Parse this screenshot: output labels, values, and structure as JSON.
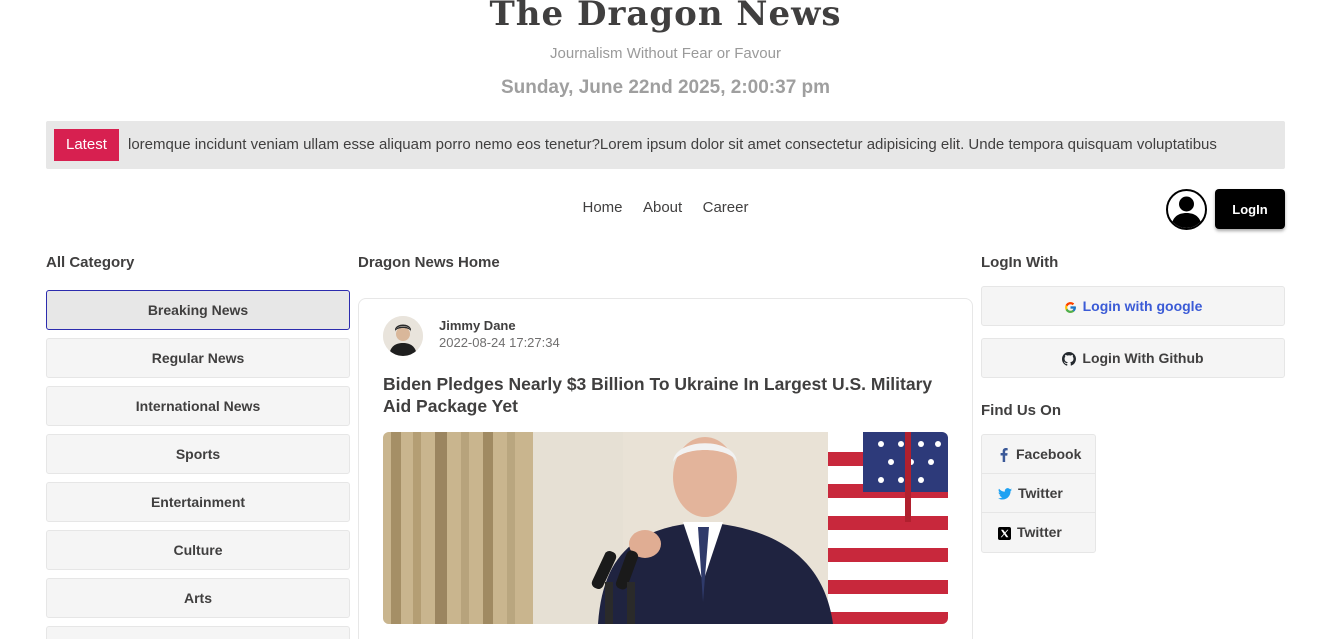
{
  "header": {
    "logo": "The Dragon News",
    "tagline": "Journalism Without Fear or Favour",
    "datetime": "Sunday, June 22nd 2025, 2:00:37 pm"
  },
  "ticker": {
    "badge": "Latest",
    "text": "loremque incidunt veniam ullam esse aliquam porro nemo eos tenetur?Lorem ipsum dolor sit amet consectetur adipisicing elit. Unde tempora quisquam voluptatibus"
  },
  "nav": {
    "items": [
      {
        "label": "Home"
      },
      {
        "label": "About"
      },
      {
        "label": "Career"
      }
    ],
    "login_label": "LogIn"
  },
  "left": {
    "title": "All Category",
    "categories": [
      {
        "label": "Breaking News"
      },
      {
        "label": "Regular News"
      },
      {
        "label": "International News"
      },
      {
        "label": "Sports"
      },
      {
        "label": "Entertainment"
      },
      {
        "label": "Culture"
      },
      {
        "label": "Arts"
      }
    ]
  },
  "main": {
    "title": "Dragon News Home",
    "article": {
      "author": "Jimmy Dane",
      "date": "2022-08-24 17:27:34",
      "headline": "Biden Pledges Nearly $3 Billion To Ukraine In Largest U.S. Military Aid Package Yet"
    }
  },
  "right": {
    "login_title": "LogIn With",
    "google_label": "Login with google",
    "github_label": "Login With Github",
    "find_title": "Find Us On",
    "social": [
      {
        "label": "Facebook",
        "icon": "facebook-icon",
        "color": "#3b5998"
      },
      {
        "label": "Twitter",
        "icon": "twitter-icon",
        "color": "#1da1f2"
      },
      {
        "label": "Twitter",
        "icon": "x-icon",
        "color": "#000000"
      }
    ]
  },
  "colors": {
    "accent": "#d72050",
    "ticker_bg": "#e7e7e7",
    "active_border": "#2c2cae"
  }
}
